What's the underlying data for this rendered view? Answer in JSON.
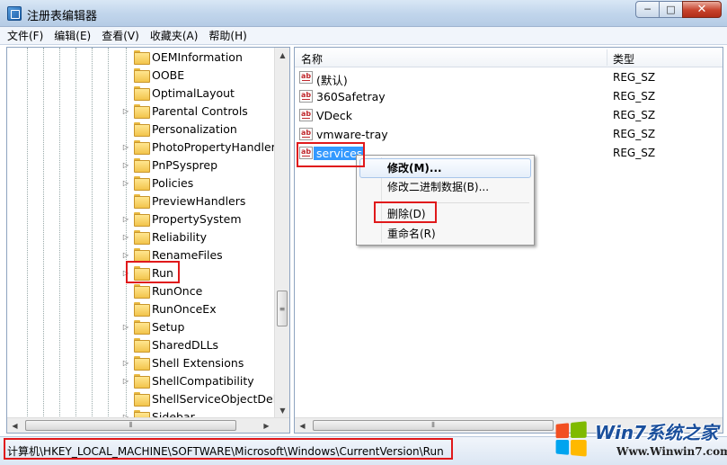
{
  "window": {
    "title": "注册表编辑器",
    "controls": {
      "minimize": "─",
      "maximize": "□",
      "close": "✕"
    }
  },
  "menu": [
    "文件(F)",
    "编辑(E)",
    "查看(V)",
    "收藏夹(A)",
    "帮助(H)"
  ],
  "tree": {
    "items": [
      {
        "label": "OEMInformation",
        "expandable": false
      },
      {
        "label": "OOBE",
        "expandable": false
      },
      {
        "label": "OptimalLayout",
        "expandable": false
      },
      {
        "label": "Parental Controls",
        "expandable": true
      },
      {
        "label": "Personalization",
        "expandable": false
      },
      {
        "label": "PhotoPropertyHandler",
        "expandable": true
      },
      {
        "label": "PnPSysprep",
        "expandable": true
      },
      {
        "label": "Policies",
        "expandable": true
      },
      {
        "label": "PreviewHandlers",
        "expandable": false
      },
      {
        "label": "PropertySystem",
        "expandable": true
      },
      {
        "label": "Reliability",
        "expandable": true
      },
      {
        "label": "RenameFiles",
        "expandable": true
      },
      {
        "label": "Run",
        "expandable": true
      },
      {
        "label": "RunOnce",
        "expandable": false
      },
      {
        "label": "RunOnceEx",
        "expandable": false
      },
      {
        "label": "Setup",
        "expandable": true
      },
      {
        "label": "SharedDLLs",
        "expandable": false
      },
      {
        "label": "Shell Extensions",
        "expandable": true
      },
      {
        "label": "ShellCompatibility",
        "expandable": true
      },
      {
        "label": "ShellServiceObjectDelay",
        "expandable": false
      },
      {
        "label": "Sidebar",
        "expandable": true
      }
    ],
    "highlighted_item": "Run"
  },
  "list": {
    "columns": {
      "name": "名称",
      "type": "类型"
    },
    "rows": [
      {
        "name": "(默认)",
        "type": "REG_SZ",
        "icon": "string-value-icon"
      },
      {
        "name": "360Safetray",
        "type": "REG_SZ",
        "icon": "string-value-icon"
      },
      {
        "name": "VDeck",
        "type": "REG_SZ",
        "icon": "string-value-icon"
      },
      {
        "name": "vmware-tray",
        "type": "REG_SZ",
        "icon": "string-value-icon"
      },
      {
        "name": "services",
        "type": "REG_SZ",
        "icon": "string-value-icon",
        "selected": true
      }
    ]
  },
  "context_menu": {
    "modify": "修改(M)...",
    "modify_binary": "修改二进制数据(B)...",
    "delete": "删除(D)",
    "rename": "重命名(R)"
  },
  "status": {
    "path": "计算机\\HKEY_LOCAL_MACHINE\\SOFTWARE\\Microsoft\\Windows\\CurrentVersion\\Run"
  },
  "watermark": {
    "title": "Win7系统之家",
    "url": "Www.Winwin7.com"
  },
  "colors": {
    "highlight_border": "#e0191b",
    "selection": "#3399ff",
    "folder": "#f2c44c"
  }
}
